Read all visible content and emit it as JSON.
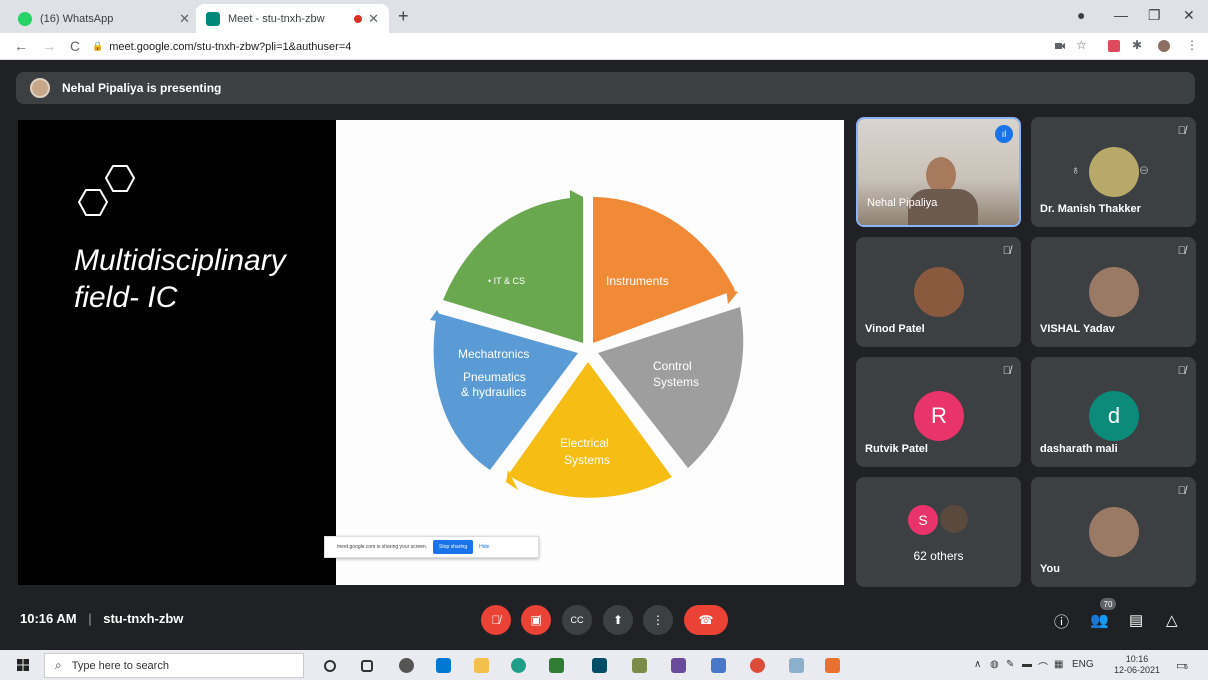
{
  "browser": {
    "tabs": [
      {
        "title": "(16) WhatsApp",
        "favicon_color": "#25d366",
        "favicon_text": "16"
      },
      {
        "title": "Meet - stu-tnxh-zbw",
        "favicon_color": "#00897b"
      }
    ],
    "url": "meet.google.com/stu-tnxh-zbw?pli=1&authuser=4"
  },
  "meet": {
    "presenting_banner": "Nehal Pipaliya is presenting",
    "slide": {
      "title_line1": "Multidisciplinary",
      "title_line2": "field- IC",
      "pie_labels": [
        "• IT & CS",
        "Instruments",
        "Control",
        "Systems",
        "Electrical",
        "Systems",
        "Mechatronics",
        "Pneumatics",
        "& hydraulics"
      ],
      "pie_colors": [
        "#6aa84f",
        "#f08a37",
        "#9e9e9e",
        "#f6bd14",
        "#5b9bd5"
      ],
      "share_notice": "meet.google.com is sharing your screen.",
      "stop_sharing": "Stop sharing",
      "hide": "Hide"
    },
    "participants": [
      {
        "name": "Nehal Pipaliya"
      },
      {
        "name": "Dr. Manish Thakker"
      },
      {
        "name": "Vinod Patel"
      },
      {
        "name": "VISHAL Yadav"
      },
      {
        "name": "Rutvik Patel",
        "initial": "R",
        "color": "#e8336b"
      },
      {
        "name": "dasharath mali",
        "initial": "d",
        "color": "#0c8b7a"
      },
      {
        "name": "62 others",
        "initial": "S",
        "color": "#e8336b"
      },
      {
        "name": "You"
      }
    ],
    "time": "10:16 AM",
    "separator": "|",
    "meeting_code": "stu-tnxh-zbw",
    "people_count": "70"
  },
  "taskbar": {
    "search_placeholder": "Type here to search",
    "lang": "ENG",
    "clock_time": "10:16",
    "clock_date": "12-06-2021",
    "notif_count": "5"
  }
}
